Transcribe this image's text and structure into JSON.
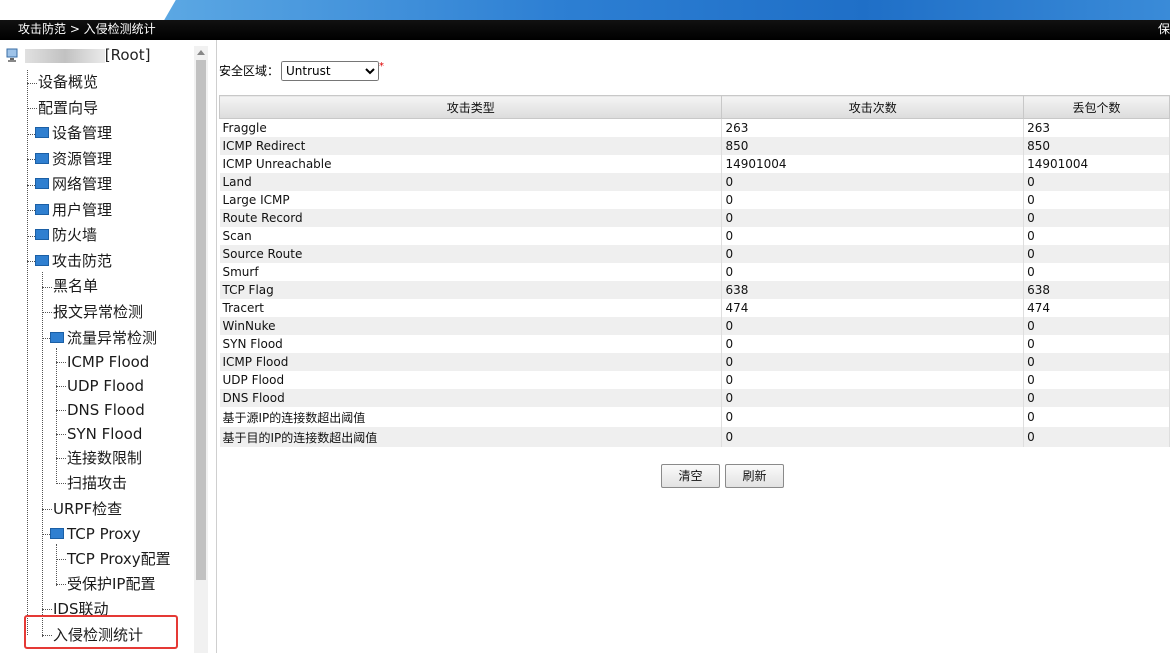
{
  "header": {
    "breadcrumb": "攻击防范 > 入侵检测统计",
    "right_text": "保"
  },
  "sidebar": {
    "root_label": "[Root]",
    "items": [
      {
        "label": "设备概览"
      },
      {
        "label": "配置向导"
      },
      {
        "label": "设备管理"
      },
      {
        "label": "资源管理"
      },
      {
        "label": "网络管理"
      },
      {
        "label": "用户管理"
      },
      {
        "label": "防火墙"
      },
      {
        "label": "攻击防范"
      },
      {
        "label": "黑名单"
      },
      {
        "label": "报文异常检测"
      },
      {
        "label": "流量异常检测"
      },
      {
        "label": "ICMP Flood"
      },
      {
        "label": "UDP Flood"
      },
      {
        "label": "DNS Flood"
      },
      {
        "label": "SYN Flood"
      },
      {
        "label": "连接数限制"
      },
      {
        "label": "扫描攻击"
      },
      {
        "label": "URPF检查"
      },
      {
        "label": "TCP Proxy"
      },
      {
        "label": "TCP Proxy配置"
      },
      {
        "label": "受保护IP配置"
      },
      {
        "label": "IDS联动"
      },
      {
        "label": "入侵检测统计"
      }
    ]
  },
  "zone": {
    "label": "安全区域：",
    "selected": "Untrust",
    "required_mark": "*"
  },
  "table": {
    "headers": [
      "攻击类型",
      "攻击次数",
      "丢包个数"
    ],
    "rows": [
      [
        "Fraggle",
        "263",
        "263"
      ],
      [
        "ICMP Redirect",
        "850",
        "850"
      ],
      [
        "ICMP Unreachable",
        "14901004",
        "14901004"
      ],
      [
        "Land",
        "0",
        "0"
      ],
      [
        "Large ICMP",
        "0",
        "0"
      ],
      [
        "Route Record",
        "0",
        "0"
      ],
      [
        "Scan",
        "0",
        "0"
      ],
      [
        "Source Route",
        "0",
        "0"
      ],
      [
        "Smurf",
        "0",
        "0"
      ],
      [
        "TCP Flag",
        "638",
        "638"
      ],
      [
        "Tracert",
        "474",
        "474"
      ],
      [
        "WinNuke",
        "0",
        "0"
      ],
      [
        "SYN Flood",
        "0",
        "0"
      ],
      [
        "ICMP Flood",
        "0",
        "0"
      ],
      [
        "UDP Flood",
        "0",
        "0"
      ],
      [
        "DNS Flood",
        "0",
        "0"
      ],
      [
        "基于源IP的连接数超出阈值",
        "0",
        "0"
      ],
      [
        "基于目的IP的连接数超出阈值",
        "0",
        "0"
      ]
    ]
  },
  "buttons": {
    "clear": "清空",
    "refresh": "刷新"
  },
  "colors": {
    "highlight": "#e53935",
    "folder": "#2f7fd0"
  }
}
